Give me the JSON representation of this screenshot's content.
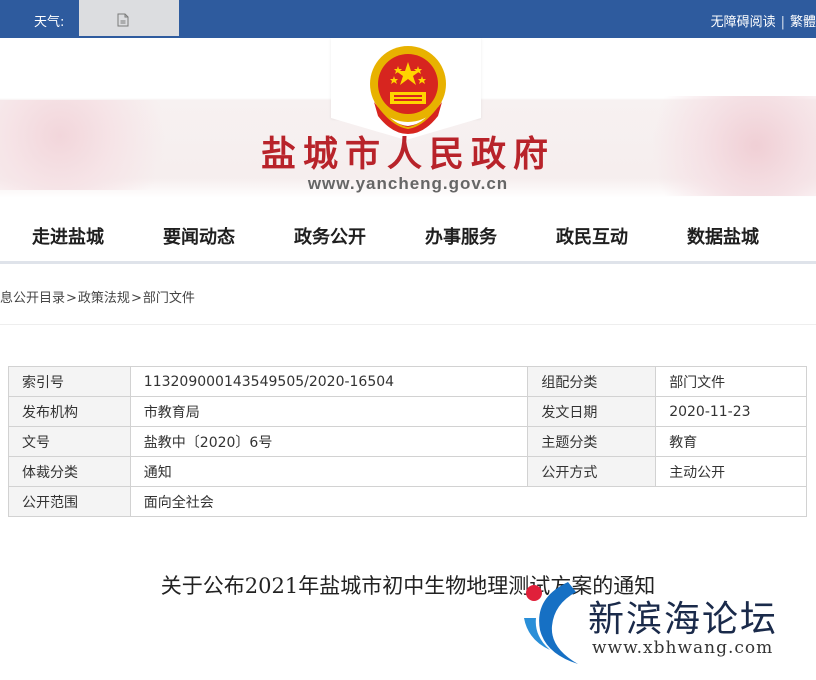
{
  "topbar": {
    "weather_label": "天气:",
    "accessibility": "无障碍阅读",
    "separator": "|",
    "traditional": "繁體"
  },
  "header": {
    "title": "盐城市人民政府",
    "url": "www.yancheng.gov.cn"
  },
  "nav": {
    "items": [
      {
        "label": "走进盐城"
      },
      {
        "label": "要闻动态"
      },
      {
        "label": "政务公开"
      },
      {
        "label": "办事服务"
      },
      {
        "label": "政民互动"
      },
      {
        "label": "数据盐城"
      }
    ]
  },
  "breadcrumb": {
    "items": [
      "息公开目录",
      "政策法规",
      "部门文件"
    ],
    "separator": ">"
  },
  "info_table": {
    "rows": [
      {
        "k1": "索引号",
        "v1": "113209000143549505/2020-16504",
        "k2": "组配分类",
        "v2": "部门文件"
      },
      {
        "k1": "发布机构",
        "v1": "市教育局",
        "k2": "发文日期",
        "v2": "2020-11-23"
      },
      {
        "k1": "文号",
        "v1": "盐教中〔2020〕6号",
        "k2": "主题分类",
        "v2": "教育"
      },
      {
        "k1": "体裁分类",
        "v1": "通知",
        "k2": "公开方式",
        "v2": "主动公开"
      },
      {
        "k1": "公开范围",
        "v1": "面向全社会"
      }
    ]
  },
  "article": {
    "title": "关于公布2021年盐城市初中生物地理测试方案的通知"
  },
  "watermark": {
    "name": "新滨海论坛",
    "url": "www.xbhwang.com"
  },
  "colors": {
    "topbar": "#2e5b9e",
    "title_red": "#b8232a",
    "weather_box": "#dcdde0"
  },
  "icons": {
    "weather": "document-icon",
    "emblem": "national-emblem"
  }
}
